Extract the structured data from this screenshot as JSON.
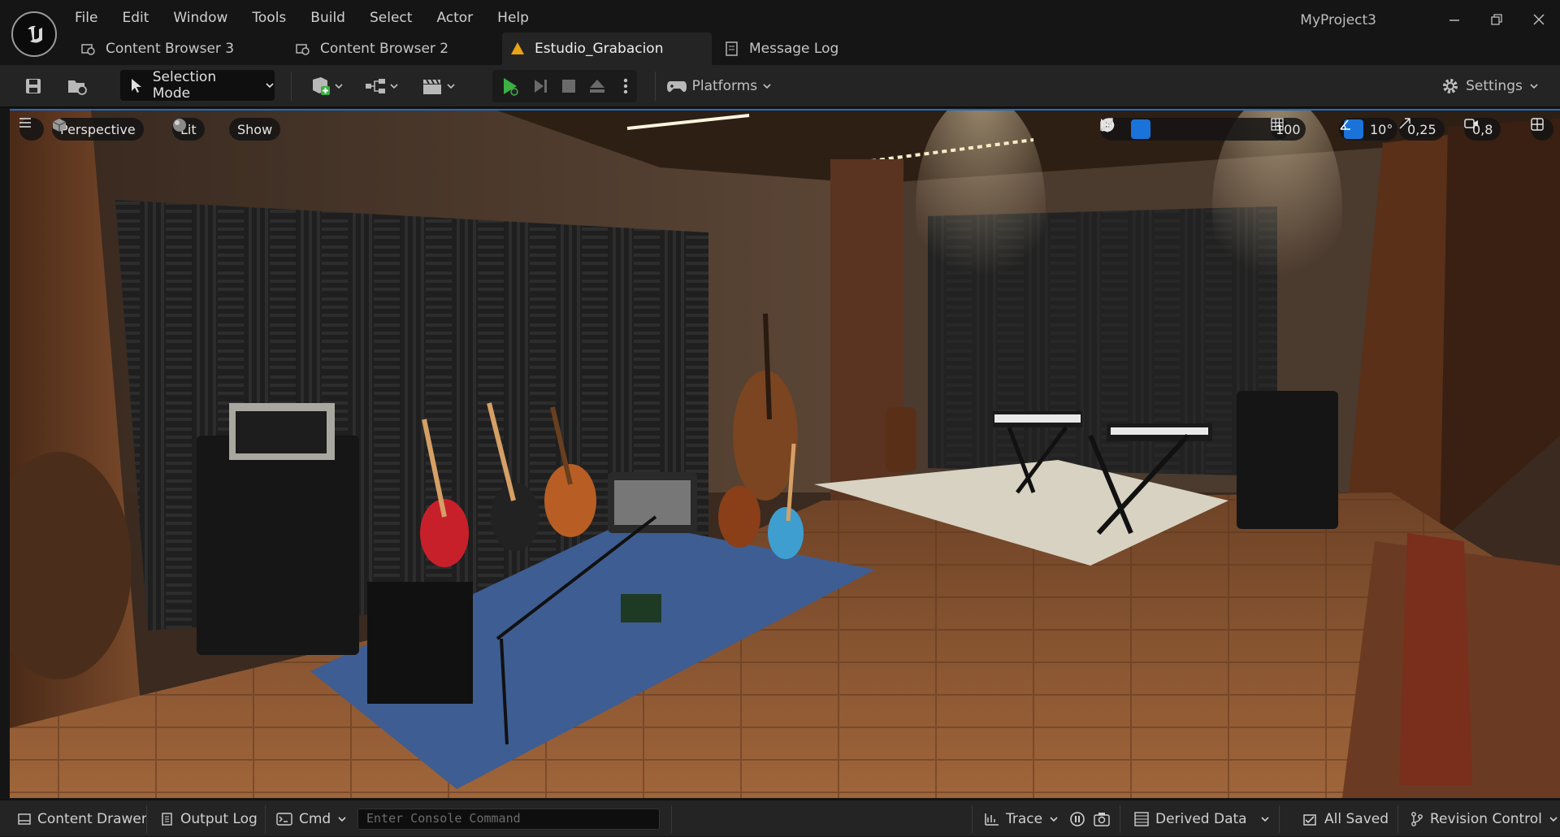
{
  "app": {
    "logo_icon": "unreal-engine-logo",
    "project_name": "MyProject3",
    "window_controls": [
      "minimize-icon",
      "restore-icon",
      "close-icon"
    ]
  },
  "menu": [
    "File",
    "Edit",
    "Window",
    "Tools",
    "Build",
    "Select",
    "Actor",
    "Help"
  ],
  "tabs": [
    {
      "label": "Content Browser 3",
      "icon": "content-browser-icon",
      "active": false
    },
    {
      "label": "Content Browser 2",
      "icon": "content-browser-icon",
      "active": false
    },
    {
      "label": "Estudio_Grabacion",
      "icon": "level-icon",
      "active": true
    },
    {
      "label": "Message Log",
      "icon": "message-log-icon",
      "active": false
    }
  ],
  "toolbar": {
    "selection_mode": "Selection Mode",
    "platforms": "Platforms",
    "settings": "Settings",
    "play_color": "#3cb043"
  },
  "viewport": {
    "perspective": "Perspective",
    "lit": "Lit",
    "show": "Show",
    "grid_snap": "100",
    "rotation_snap": "10°",
    "scale_snap": "0,25",
    "camera_speed": "0,8",
    "accent_color": "#1a73d9"
  },
  "statusbar": {
    "content_drawer": "Content Drawer",
    "output_log": "Output Log",
    "cmd": "Cmd",
    "console_placeholder": "Enter Console Command",
    "trace": "Trace",
    "derived_data": "Derived Data",
    "all_saved": "All Saved",
    "revision_control": "Revision Control"
  }
}
